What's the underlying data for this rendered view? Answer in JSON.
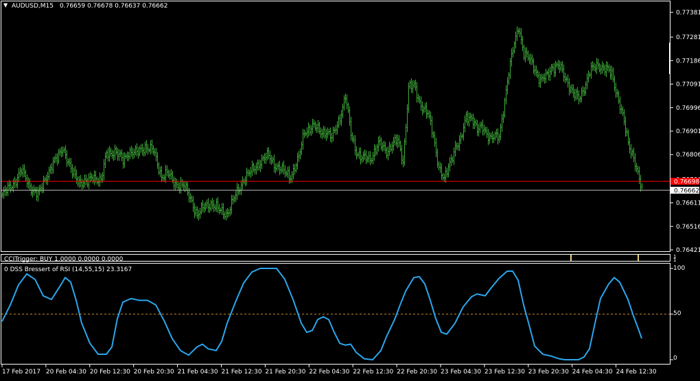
{
  "main_header": {
    "menu_arrow": "▼",
    "symbol": "AUDUSD,M15",
    "ohlc": "0.76659 0.76678 0.76637 0.76662"
  },
  "indicator1": {
    "label": "CCITrigger: BUY 1.0000 0.0000 0.0000",
    "scale_top": "1",
    "scale_bottom": "1"
  },
  "indicator2": {
    "label": "0 DSS Bressert of RSI (14,55,15) 23.3167",
    "y_labels": [
      "100",
      "50",
      "0"
    ]
  },
  "colors": {
    "background": "#000000",
    "candles": "#3fae3a",
    "red_line": "#ff0000",
    "bid_line": "#c0c0c0",
    "dss_line": "#2ba7ee",
    "level_line": "#c68a2c",
    "grid": "#ffffff",
    "trigger_bar": "#e8d27a"
  },
  "chart_data": [
    {
      "type": "candlestick",
      "symbol": "AUDUSD",
      "timeframe": "M15",
      "ylim": [
        0.76421,
        0.77381
      ],
      "y_ticks": [
        "0.77381",
        "0.77281",
        "0.77186",
        "0.77091",
        "0.76996",
        "0.76901",
        "0.76806",
        "0.76706",
        "0.76611",
        "0.76516",
        "0.76421"
      ],
      "x_ticks": [
        "17 Feb 2017",
        "20 Feb 04:30",
        "20 Feb 12:30",
        "20 Feb 20:30",
        "21 Feb 04:30",
        "21 Feb 12:30",
        "21 Feb 20:30",
        "22 Feb 04:30",
        "22 Feb 12:30",
        "22 Feb 20:30",
        "23 Feb 04:30",
        "23 Feb 12:30",
        "23 Feb 20:30",
        "24 Feb 04:30",
        "24 Feb 12:30"
      ],
      "red_level": 0.76698,
      "red_level_label": "0.76698",
      "bid_level": 0.76662,
      "bid_label": "0.76662",
      "close_anchors": [
        [
          0,
          0.7664
        ],
        [
          8,
          0.7669
        ],
        [
          14,
          0.7674
        ],
        [
          20,
          0.7668
        ],
        [
          26,
          0.7664
        ],
        [
          32,
          0.7672
        ],
        [
          36,
          0.7676
        ],
        [
          40,
          0.7679
        ],
        [
          44,
          0.7684
        ],
        [
          50,
          0.7674
        ],
        [
          56,
          0.767
        ],
        [
          62,
          0.7669
        ],
        [
          66,
          0.7672
        ],
        [
          72,
          0.767
        ],
        [
          76,
          0.7681
        ],
        [
          82,
          0.7682
        ],
        [
          88,
          0.7678
        ],
        [
          92,
          0.7682
        ],
        [
          98,
          0.7681
        ],
        [
          104,
          0.7684
        ],
        [
          110,
          0.7682
        ],
        [
          116,
          0.7672
        ],
        [
          120,
          0.7673
        ],
        [
          126,
          0.7669
        ],
        [
          132,
          0.7668
        ],
        [
          138,
          0.7662
        ],
        [
          142,
          0.7656
        ],
        [
          148,
          0.766
        ],
        [
          152,
          0.7661
        ],
        [
          158,
          0.7658
        ],
        [
          164,
          0.7657
        ],
        [
          170,
          0.7664
        ],
        [
          176,
          0.7671
        ],
        [
          182,
          0.7674
        ],
        [
          188,
          0.7678
        ],
        [
          194,
          0.768
        ],
        [
          198,
          0.7677
        ],
        [
          204,
          0.7674
        ],
        [
          210,
          0.7672
        ],
        [
          216,
          0.7679
        ],
        [
          220,
          0.769
        ],
        [
          226,
          0.7692
        ],
        [
          232,
          0.769
        ],
        [
          236,
          0.769
        ],
        [
          240,
          0.7687
        ],
        [
          246,
          0.7696
        ],
        [
          250,
          0.7704
        ],
        [
          254,
          0.7689
        ],
        [
          258,
          0.7682
        ],
        [
          262,
          0.7679
        ],
        [
          268,
          0.7679
        ],
        [
          274,
          0.7685
        ],
        [
          280,
          0.7682
        ],
        [
          284,
          0.7685
        ],
        [
          288,
          0.7686
        ],
        [
          292,
          0.7678
        ],
        [
          296,
          0.7708
        ],
        [
          300,
          0.7708
        ],
        [
          304,
          0.7702
        ],
        [
          310,
          0.7697
        ],
        [
          314,
          0.7688
        ],
        [
          318,
          0.7676
        ],
        [
          322,
          0.767
        ],
        [
          326,
          0.7677
        ],
        [
          330,
          0.7684
        ],
        [
          334,
          0.7686
        ],
        [
          338,
          0.7696
        ],
        [
          342,
          0.7696
        ],
        [
          346,
          0.769
        ],
        [
          350,
          0.7692
        ],
        [
          356,
          0.7687
        ],
        [
          362,
          0.7688
        ],
        [
          368,
          0.771
        ],
        [
          372,
          0.7723
        ],
        [
          376,
          0.7733
        ],
        [
          380,
          0.7721
        ],
        [
          386,
          0.7718
        ],
        [
          392,
          0.771
        ],
        [
          396,
          0.7712
        ],
        [
          400,
          0.7716
        ],
        [
          406,
          0.7716
        ],
        [
          412,
          0.771
        ],
        [
          416,
          0.7705
        ],
        [
          420,
          0.7703
        ],
        [
          424,
          0.7708
        ],
        [
          428,
          0.7714
        ],
        [
          434,
          0.7717
        ],
        [
          440,
          0.7715
        ],
        [
          444,
          0.7713
        ],
        [
          448,
          0.7705
        ],
        [
          452,
          0.7696
        ],
        [
          456,
          0.7685
        ],
        [
          460,
          0.768
        ],
        [
          464,
          0.767
        ],
        [
          466,
          0.76662
        ]
      ]
    },
    {
      "type": "line",
      "title": "DSS Bressert of RSI (14,55,15)",
      "ylim": [
        0,
        100
      ],
      "level": 50,
      "last_value": 23.3167,
      "series": [
        {
          "points": [
            [
              0,
              42
            ],
            [
              6,
              60
            ],
            [
              12,
              82
            ],
            [
              18,
              94
            ],
            [
              24,
              88
            ],
            [
              30,
              70
            ],
            [
              36,
              66
            ],
            [
              42,
              80
            ],
            [
              46,
              90
            ],
            [
              50,
              85
            ],
            [
              54,
              65
            ],
            [
              58,
              40
            ],
            [
              64,
              18
            ],
            [
              70,
              6
            ],
            [
              76,
              6
            ],
            [
              80,
              14
            ],
            [
              84,
              45
            ],
            [
              88,
              63
            ],
            [
              94,
              67
            ],
            [
              100,
              65
            ],
            [
              106,
              65
            ],
            [
              112,
              60
            ],
            [
              118,
              43
            ],
            [
              124,
              23
            ],
            [
              130,
              10
            ],
            [
              136,
              5
            ],
            [
              142,
              14
            ],
            [
              146,
              17
            ],
            [
              150,
              12
            ],
            [
              156,
              10
            ],
            [
              160,
              20
            ],
            [
              164,
              40
            ],
            [
              170,
              63
            ],
            [
              176,
              84
            ],
            [
              182,
              96
            ],
            [
              188,
              100
            ],
            [
              194,
              100
            ],
            [
              200,
              100
            ],
            [
              206,
              88
            ],
            [
              212,
              66
            ],
            [
              218,
              40
            ],
            [
              222,
              30
            ],
            [
              226,
              32
            ],
            [
              230,
              44
            ],
            [
              234,
              47
            ],
            [
              238,
              44
            ],
            [
              242,
              30
            ],
            [
              246,
              18
            ],
            [
              250,
              16
            ],
            [
              254,
              17
            ],
            [
              258,
              8
            ],
            [
              264,
              1
            ],
            [
              270,
              0
            ],
            [
              276,
              10
            ],
            [
              280,
              25
            ],
            [
              286,
              44
            ],
            [
              290,
              60
            ],
            [
              294,
              75
            ],
            [
              300,
              90
            ],
            [
              304,
              91
            ],
            [
              308,
              83
            ],
            [
              312,
              65
            ],
            [
              316,
              45
            ],
            [
              320,
              30
            ],
            [
              324,
              28
            ],
            [
              330,
              40
            ],
            [
              336,
              58
            ],
            [
              342,
              69
            ],
            [
              346,
              72
            ],
            [
              352,
              70
            ],
            [
              356,
              78
            ],
            [
              362,
              89
            ],
            [
              368,
              97
            ],
            [
              372,
              97
            ],
            [
              376,
              87
            ],
            [
              380,
              60
            ],
            [
              384,
              38
            ],
            [
              388,
              15
            ],
            [
              394,
              6
            ],
            [
              400,
              4
            ],
            [
              406,
              1
            ],
            [
              410,
              0
            ],
            [
              416,
              0
            ],
            [
              420,
              0
            ],
            [
              424,
              3
            ],
            [
              428,
              12
            ],
            [
              432,
              40
            ],
            [
              436,
              67
            ],
            [
              442,
              83
            ],
            [
              446,
              90
            ],
            [
              450,
              85
            ],
            [
              456,
              66
            ],
            [
              460,
              48
            ],
            [
              464,
              32
            ],
            [
              466,
              23.3167
            ]
          ]
        }
      ]
    }
  ]
}
